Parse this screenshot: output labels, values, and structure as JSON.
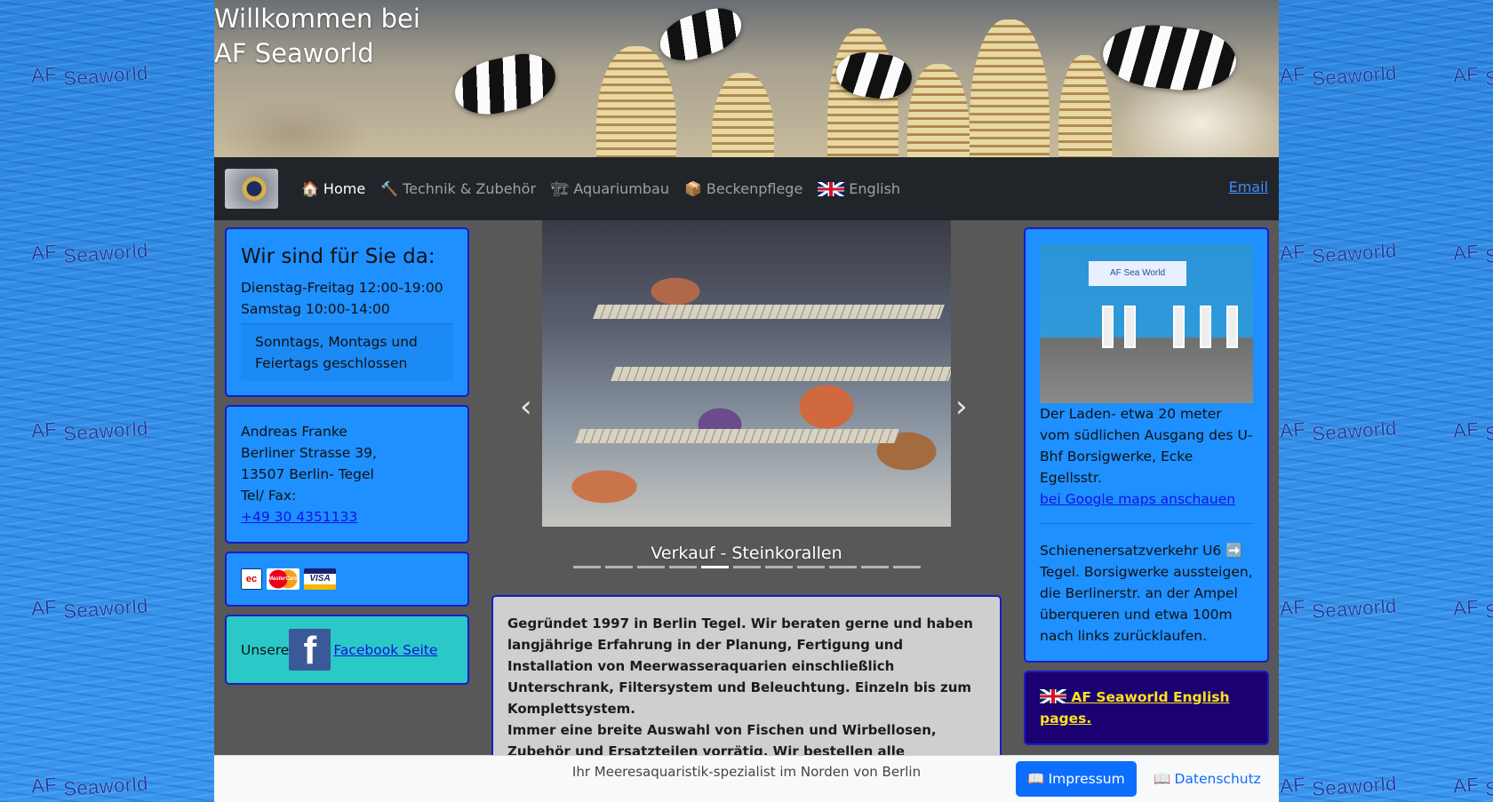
{
  "watermark": {
    "line1": "AF",
    "line2": "Seaworld"
  },
  "banner": {
    "title_line1": "Willkommen bei",
    "title_line2": "AF Seaworld"
  },
  "nav": {
    "items": [
      {
        "label": "Home",
        "icon": "house-icon",
        "active": true
      },
      {
        "label": "Technik & Zubehör",
        "icon": "tools-icon",
        "active": false
      },
      {
        "label": "Aquariumbau",
        "icon": "construction-icon",
        "active": false
      },
      {
        "label": "Beckenpflege",
        "icon": "care-box-icon",
        "active": false
      },
      {
        "label": "English",
        "icon": "uk-flag-icon",
        "active": false
      }
    ],
    "email_label": "Email"
  },
  "hours": {
    "title": "Wir sind für Sie da:",
    "line1": "Dienstag-Freitag 12:00-19:00",
    "line2": "Samstag 10:00-14:00",
    "closed": "Sonntags, Montags und Feiertags geschlossen"
  },
  "address": {
    "name": "Andreas Franke",
    "street": "Berliner Strasse 39,",
    "city": "13507 Berlin- Tegel",
    "phone_label": "Tel/ Fax:",
    "phone": "+49 30 4351133"
  },
  "payments": [
    {
      "name": "ec-card-icon",
      "label": "ec"
    },
    {
      "name": "mastercard-icon",
      "label": "MasterCard"
    },
    {
      "name": "visa-icon",
      "label": "VISA"
    }
  ],
  "facebook": {
    "prefix": "Unsere",
    "icon_letter": "f",
    "link": "Facebook Seite"
  },
  "carousel": {
    "caption": "Verkauf - Steinkorallen",
    "prev": "‹",
    "next": "›",
    "slide_count": 11,
    "active_index": 4
  },
  "about": {
    "p1": "Gegründet 1997 in Berlin Tegel. Wir beraten gerne und haben langjährige Erfahrung in der Planung, Fertigung und Installation von Meerwasseraquarien einschließlich Unterschrank, Filtersystem und Beleuchtung. Einzeln bis zum Komplettsystem.",
    "p2": "Immer eine breite Auswahl von Fischen und Wirbellosen, Zubehör und Ersatzteilen vorrätig. Wir bestellen alle lieferbaren Teile für Sie."
  },
  "shop": {
    "sign": "AF Sea World",
    "text": "Der Laden- etwa 20 meter vom südlichen Ausgang des U-Bhf Borsigwerke, Ecke Egellsstr.",
    "maps_link": "bei Google maps anschauen",
    "notice": "Schienenersatzverkehr U6 ➡️ Tegel. Borsigwerke aussteigen, die Berlinerstr. an der Ampel überqueren und etwa 100m nach links zurücklaufen."
  },
  "english_card": {
    "link": "AF Seaworld English pages."
  },
  "footer": {
    "text": "Ihr Meeresaquaristik-spezialist im Norden von Berlin",
    "impressum": "Impressum",
    "datenschutz": "Datenschutz"
  },
  "colors": {
    "card_blue": "#1e90ff",
    "card_border": "#1a1acb",
    "facebook_card": "#2ac9c7",
    "english_card": "#1a0070",
    "link_yellow": "#ffe21f",
    "navbar": "#212529",
    "primary": "#0d6efd"
  }
}
